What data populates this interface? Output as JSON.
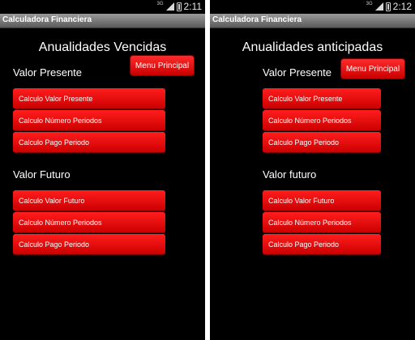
{
  "left": {
    "status_time": "2:11",
    "network": "3G",
    "app_title": "Calculadora Financiera",
    "heading": "Anualidades Vencidas",
    "menu_label": "Menu Principal",
    "present_section": "Valor Presente",
    "present_buttons": [
      "Calculo Valor Presente",
      "Calculo Número Periodos",
      "Calculo Pago Periodo"
    ],
    "future_section": "Valor Futuro",
    "future_buttons": [
      "Calculo Valor Futuro",
      "Calculo Número Periodos",
      "Calculo Pago Periodo"
    ]
  },
  "right": {
    "status_time": "2:12",
    "network": "3G",
    "app_title": "Calculadora Financiera",
    "heading": "Anualidades anticipadas",
    "menu_label": "Menu Principal",
    "present_section": "Valor Presente",
    "present_buttons": [
      "Calculo Valor Presente",
      "Calculo Número Periodos",
      "Calculo Pago Periodo"
    ],
    "future_section": "Valor futuro",
    "future_buttons": [
      "Calculo Valor Futuro",
      "Calculo Número Periodos",
      "Calculo Pago Periodo"
    ]
  },
  "colors": {
    "button_red": "#e60000",
    "screen_bg": "#000000",
    "titlebar_gray": "#7a7a7a"
  }
}
